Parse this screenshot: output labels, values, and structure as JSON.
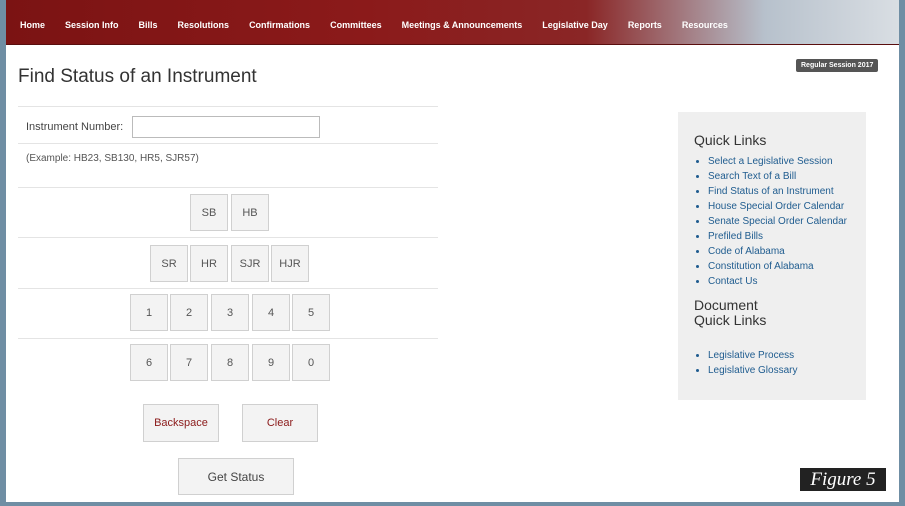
{
  "nav": {
    "items": [
      "Home",
      "Session Info",
      "Bills",
      "Resolutions",
      "Confirmations",
      "Committees",
      "Meetings & Announcements",
      "Legislative Day",
      "Reports",
      "Resources"
    ]
  },
  "session_badge": "Regular Session 2017",
  "page_title": "Find Status of an Instrument",
  "form": {
    "instrument_label": "Instrument Number:",
    "instrument_value": "",
    "example": "(Example: HB23, SB130, HR5, SJR57)"
  },
  "keypad": {
    "row1": [
      "SB",
      "HB"
    ],
    "row2": [
      "SR",
      "HR",
      "SJR",
      "HJR"
    ],
    "row3": [
      "1",
      "2",
      "3",
      "4",
      "5"
    ],
    "row4": [
      "6",
      "7",
      "8",
      "9",
      "0"
    ],
    "backspace": "Backspace",
    "clear": "Clear",
    "get_status": "Get Status"
  },
  "quick_links": {
    "title": "Quick Links",
    "items": [
      "Select a Legislative Session",
      "Search Text of a Bill",
      "Find Status of an Instrument",
      "House Special Order Calendar",
      "Senate Special Order Calendar",
      "Prefiled Bills",
      "Code of Alabama",
      "Constitution of Alabama",
      "Contact Us"
    ]
  },
  "document_quick_links": {
    "title": "Document Quick Links",
    "items": [
      "Legislative Process",
      "Legislative Glossary"
    ]
  },
  "figure_label": "Figure 5",
  "colors": {
    "nav_red": "#8b1a1a",
    "link_blue": "#1f5c8f",
    "accent_red": "#8b1a1a"
  }
}
